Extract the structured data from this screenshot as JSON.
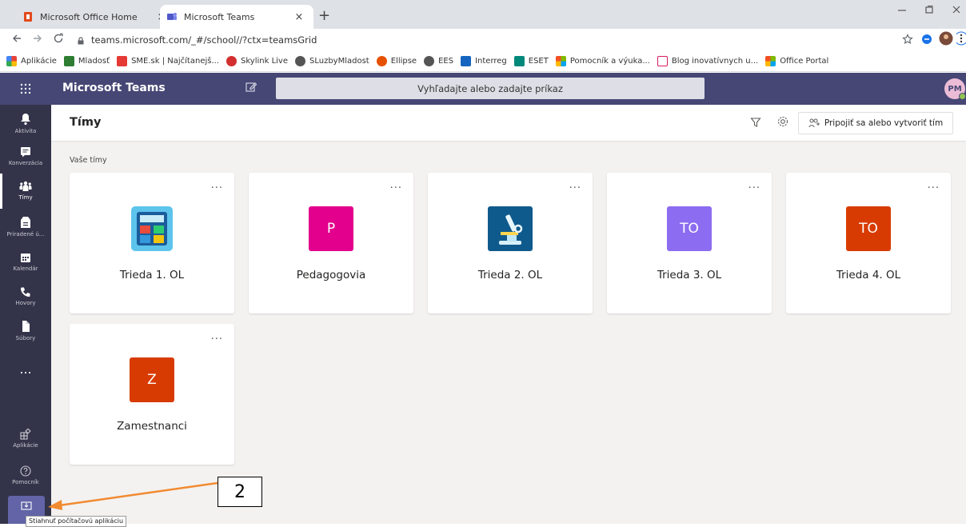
{
  "browser": {
    "tabs": [
      {
        "label": "Microsoft Office Home",
        "active": false,
        "icon": "office-icon"
      },
      {
        "label": "Microsoft Teams",
        "active": true,
        "icon": "teams-icon"
      }
    ],
    "close_glyph": "×",
    "new_tab_glyph": "+",
    "url": "teams.microsoft.com/_#/school//?ctx=teamsGrid",
    "bookmarks": [
      {
        "label": "Aplikácie",
        "color": "#4285f4"
      },
      {
        "label": "Mladosť",
        "color": "#2e7d32"
      },
      {
        "label": "SME.sk | Najčítanejš...",
        "color": "#e53935"
      },
      {
        "label": "Skylink Live",
        "color": "#d32f2f"
      },
      {
        "label": "SLuzbyMladost",
        "color": "#555555"
      },
      {
        "label": "Ellipse",
        "color": "#e65100"
      },
      {
        "label": "EES",
        "color": "#555555"
      },
      {
        "label": "Interreg",
        "color": "#1565c0"
      },
      {
        "label": "ESET",
        "color": "#00897b"
      },
      {
        "label": "Pomocník a výuka...",
        "color": "#f25022"
      },
      {
        "label": "Blog inovatívnych u...",
        "color": "#d81b60"
      },
      {
        "label": "Office Portal",
        "color": "#f25022"
      }
    ]
  },
  "teams": {
    "app_title": "Microsoft Teams",
    "search_placeholder": "Vyhľadajte alebo zadajte príkaz",
    "avatar_initials": "PM",
    "rail": [
      {
        "label": "Aktivita",
        "icon": "bell-icon"
      },
      {
        "label": "Konverzácia",
        "icon": "chat-icon"
      },
      {
        "label": "Tímy",
        "icon": "teams-people-icon",
        "active": true
      },
      {
        "label": "Priradené ú...",
        "icon": "assignments-icon"
      },
      {
        "label": "Kalendár",
        "icon": "calendar-icon"
      },
      {
        "label": "Hovory",
        "icon": "phone-icon"
      },
      {
        "label": "Súbory",
        "icon": "file-icon"
      },
      {
        "label": "...",
        "icon": "more-icon"
      },
      {
        "label": "Aplikácie",
        "icon": "apps-icon"
      },
      {
        "label": "Pomocník",
        "icon": "help-icon"
      }
    ],
    "page_title": "Tímy",
    "join_button": "Pripojiť sa alebo vytvoriť tím",
    "section_label": "Vaše tímy",
    "more_glyph": "...",
    "teams_list": [
      {
        "name": "Trieda 1. OL",
        "tile": "calculator-icon",
        "color": "#ffffff"
      },
      {
        "name": "Pedagogovia",
        "tile": "P",
        "color": "#e3008c"
      },
      {
        "name": "Trieda 2. OL",
        "tile": "microscope-icon",
        "color": "#0f5a8c"
      },
      {
        "name": "Trieda 3. OL",
        "tile": "TO",
        "color": "#8c6cf0"
      },
      {
        "name": "Trieda 4. OL",
        "tile": "TO",
        "color": "#d83b01"
      },
      {
        "name": "Zamestnanci",
        "tile": "Z",
        "color": "#d83b01"
      }
    ],
    "download_tooltip": "Stiahnuť počítačovú aplikáciu"
  },
  "annotation": {
    "label": "2",
    "arrow_color": "#f28a30"
  }
}
